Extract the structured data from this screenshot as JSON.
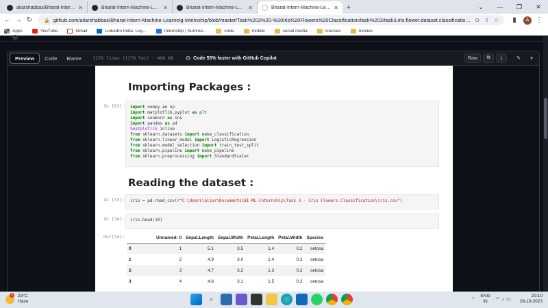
{
  "browser": {
    "tabs": [
      {
        "title": "aliarshabbas/Bharat-Intern-Mac",
        "active": false
      },
      {
        "title": "Bharat-Intern-Machine-Learning",
        "active": false
      },
      {
        "title": "Bharat-Intern-Machine-Learning",
        "active": false
      },
      {
        "title": "Bharat-Intern-Machine-Learning",
        "active": true
      }
    ],
    "url": "github.com/aliarshabbas/Bharat-Intern-Machine-Learning-Internship/blob/master/Task%203%20-%20Iris%20Flowers%20Classification/task%203/task3.iris.flower.dataset.classification.ipy...",
    "avatar_letter": "A",
    "bookmarks": [
      {
        "label": "Apps",
        "icon": "apps-grid-icon"
      },
      {
        "label": "YouTube",
        "icon": "youtube-icon"
      },
      {
        "label": "Gmail",
        "icon": "gmail-icon"
      },
      {
        "label": "LinkedIn India: Log...",
        "icon": "linkedin-icon"
      },
      {
        "label": "Internship | Summe...",
        "icon": "internshala-icon"
      },
      {
        "label": "code",
        "icon": "folder-icon"
      },
      {
        "label": "mobile",
        "icon": "folder-icon"
      },
      {
        "label": "social media",
        "icon": "folder-icon"
      },
      {
        "label": "courses",
        "icon": "folder-icon"
      },
      {
        "label": "movies",
        "icon": "folder-icon"
      }
    ]
  },
  "github": {
    "views": [
      "Preview",
      "Code",
      "Blame"
    ],
    "file_info": "1170 lines (1170 loc) · 408 KB",
    "copilot": "Code 55% faster with GitHub Copilot",
    "raw_label": "Raw"
  },
  "notebook": {
    "heading1": "Importing Packages :",
    "prompt1": "In [63]:",
    "heading2": "Reading the dataset :",
    "prompt2": "In [33]:",
    "prompt3": "In [34]:",
    "code3": "iris.head(10)",
    "prompt4": "Out[34]:",
    "table": {
      "columns": [
        "",
        "Unnamed: 0",
        "Sepal.Length",
        "Sepal.Width",
        "Petal.Length",
        "Petal.Width",
        "Species"
      ],
      "rows": [
        [
          "0",
          "1",
          "5.1",
          "3.5",
          "1.4",
          "0.2",
          "setosa"
        ],
        [
          "1",
          "2",
          "4.9",
          "3.0",
          "1.4",
          "0.2",
          "setosa"
        ],
        [
          "2",
          "3",
          "4.7",
          "3.2",
          "1.3",
          "0.2",
          "setosa"
        ],
        [
          "3",
          "4",
          "4.6",
          "3.1",
          "1.5",
          "0.2",
          "setosa"
        ]
      ]
    }
  },
  "taskbar": {
    "temp": "23°C",
    "weather": "Haze",
    "badge": "1",
    "lang_top": "ENG",
    "lang_bottom": "IN",
    "time": "20:10",
    "date": "28-10-2023"
  }
}
